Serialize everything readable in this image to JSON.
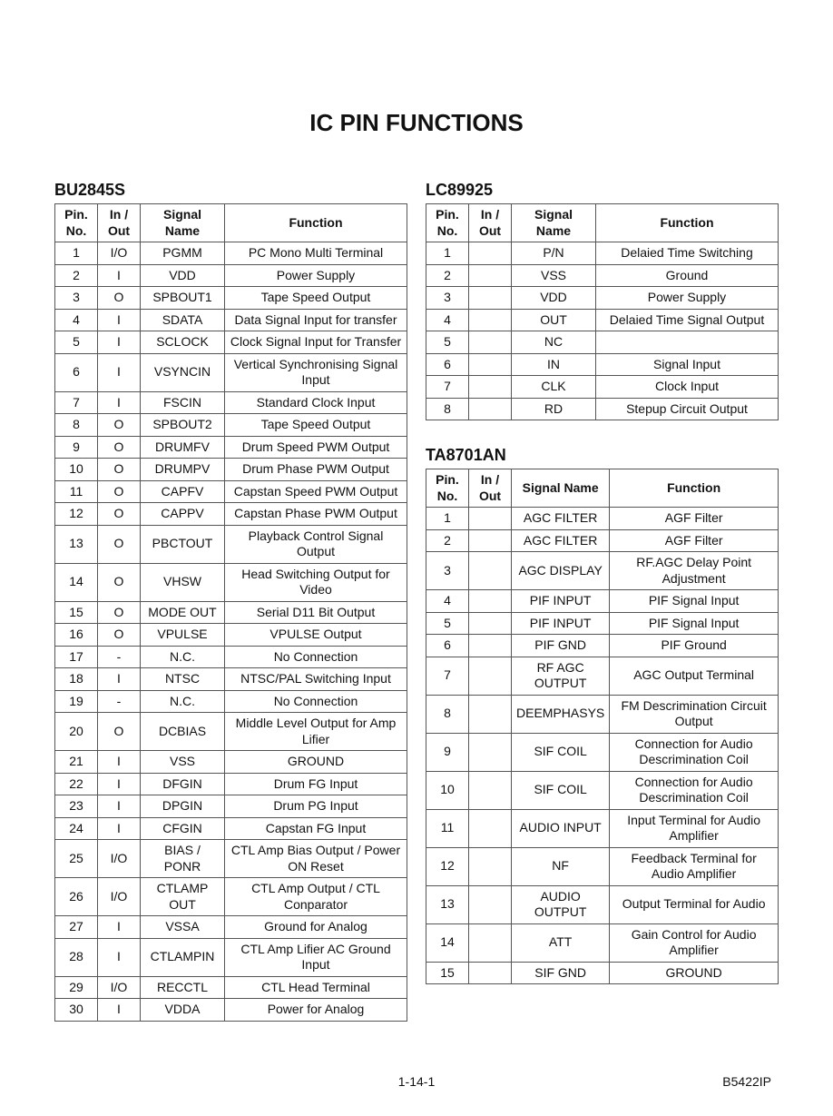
{
  "page_title": "IC PIN FUNCTIONS",
  "footer_center": "1-14-1",
  "footer_right": "B5422IP",
  "headers": {
    "pin": "Pin.\nNo.",
    "io": "In /\nOut",
    "signal": "Signal\nName",
    "func": "Function"
  },
  "tables": [
    {
      "title": "BU2845S",
      "rows": [
        {
          "pin": "1",
          "io": "I/O",
          "signal": "PGMM",
          "func": "PC Mono Multi Terminal"
        },
        {
          "pin": "2",
          "io": "I",
          "signal": "VDD",
          "func": "Power Supply"
        },
        {
          "pin": "3",
          "io": "O",
          "signal": "SPBOUT1",
          "func": "Tape Speed Output"
        },
        {
          "pin": "4",
          "io": "I",
          "signal": "SDATA",
          "func": "Data Signal Input for transfer"
        },
        {
          "pin": "5",
          "io": "I",
          "signal": "SCLOCK",
          "func": "Clock Signal Input for Transfer"
        },
        {
          "pin": "6",
          "io": "I",
          "signal": "VSYNCIN",
          "func": "Vertical Synchronising Signal Input"
        },
        {
          "pin": "7",
          "io": "I",
          "signal": "FSCIN",
          "func": "Standard Clock Input"
        },
        {
          "pin": "8",
          "io": "O",
          "signal": "SPBOUT2",
          "func": "Tape Speed Output"
        },
        {
          "pin": "9",
          "io": "O",
          "signal": "DRUMFV",
          "func": "Drum Speed PWM Output"
        },
        {
          "pin": "10",
          "io": "O",
          "signal": "DRUMPV",
          "func": "Drum Phase PWM Output"
        },
        {
          "pin": "11",
          "io": "O",
          "signal": "CAPFV",
          "func": "Capstan Speed PWM Output"
        },
        {
          "pin": "12",
          "io": "O",
          "signal": "CAPPV",
          "func": "Capstan Phase PWM Output"
        },
        {
          "pin": "13",
          "io": "O",
          "signal": "PBCTOUT",
          "func": "Playback Control Signal Output"
        },
        {
          "pin": "14",
          "io": "O",
          "signal": "VHSW",
          "func": "Head Switching Output for Video"
        },
        {
          "pin": "15",
          "io": "O",
          "signal": "MODE OUT",
          "func": "Serial D11 Bit Output"
        },
        {
          "pin": "16",
          "io": "O",
          "signal": "VPULSE",
          "func": "VPULSE Output"
        },
        {
          "pin": "17",
          "io": "-",
          "signal": "N.C.",
          "func": "No Connection"
        },
        {
          "pin": "18",
          "io": "I",
          "signal": "NTSC",
          "func": "NTSC/PAL Switching Input"
        },
        {
          "pin": "19",
          "io": "-",
          "signal": "N.C.",
          "func": "No Connection"
        },
        {
          "pin": "20",
          "io": "O",
          "signal": "DCBIAS",
          "func": "Middle Level Output for Amp Lifier"
        },
        {
          "pin": "21",
          "io": "I",
          "signal": "VSS",
          "func": "GROUND"
        },
        {
          "pin": "22",
          "io": "I",
          "signal": "DFGIN",
          "func": "Drum FG Input"
        },
        {
          "pin": "23",
          "io": "I",
          "signal": "DPGIN",
          "func": "Drum PG Input"
        },
        {
          "pin": "24",
          "io": "I",
          "signal": "CFGIN",
          "func": "Capstan FG Input"
        },
        {
          "pin": "25",
          "io": "I/O",
          "signal": "BIAS / PONR",
          "func": "CTL Amp Bias Output / Power ON Reset"
        },
        {
          "pin": "26",
          "io": "I/O",
          "signal": "CTLAMP OUT",
          "func": "CTL Amp Output / CTL Conparator"
        },
        {
          "pin": "27",
          "io": "I",
          "signal": "VSSA",
          "func": "Ground for Analog"
        },
        {
          "pin": "28",
          "io": "I",
          "signal": "CTLAMPIN",
          "func": "CTL Amp Lifier AC Ground Input"
        },
        {
          "pin": "29",
          "io": "I/O",
          "signal": "RECCTL",
          "func": "CTL Head Terminal"
        },
        {
          "pin": "30",
          "io": "I",
          "signal": "VDDA",
          "func": "Power for Analog"
        }
      ]
    },
    {
      "title": "LC89925",
      "rows": [
        {
          "pin": "1",
          "io": "",
          "signal": "P/N",
          "func": "Delaied Time Switching"
        },
        {
          "pin": "2",
          "io": "",
          "signal": "VSS",
          "func": "Ground"
        },
        {
          "pin": "3",
          "io": "",
          "signal": "VDD",
          "func": "Power Supply"
        },
        {
          "pin": "4",
          "io": "",
          "signal": "OUT",
          "func": "Delaied Time Signal Output"
        },
        {
          "pin": "5",
          "io": "",
          "signal": "NC",
          "func": ""
        },
        {
          "pin": "6",
          "io": "",
          "signal": "IN",
          "func": "Signal Input"
        },
        {
          "pin": "7",
          "io": "",
          "signal": "CLK",
          "func": "Clock Input"
        },
        {
          "pin": "8",
          "io": "",
          "signal": "RD",
          "func": "Stepup Circuit Output"
        }
      ]
    },
    {
      "title": "TA8701AN",
      "rows": [
        {
          "pin": "1",
          "io": "",
          "signal": "AGC FILTER",
          "func": "AGF Filter"
        },
        {
          "pin": "2",
          "io": "",
          "signal": "AGC FILTER",
          "func": "AGF Filter"
        },
        {
          "pin": "3",
          "io": "",
          "signal": "AGC DISPLAY",
          "func": "RF.AGC Delay Point Adjustment"
        },
        {
          "pin": "4",
          "io": "",
          "signal": "PIF INPUT",
          "func": "PIF Signal Input"
        },
        {
          "pin": "5",
          "io": "",
          "signal": "PIF INPUT",
          "func": "PIF Signal Input"
        },
        {
          "pin": "6",
          "io": "",
          "signal": "PIF GND",
          "func": "PIF Ground"
        },
        {
          "pin": "7",
          "io": "",
          "signal": "RF AGC OUTPUT",
          "func": "AGC Output Terminal"
        },
        {
          "pin": "8",
          "io": "",
          "signal": "DEEMPHASYS",
          "func": "FM Descrimination Circuit Output"
        },
        {
          "pin": "9",
          "io": "",
          "signal": "SIF COIL",
          "func": "Connection for Audio Descrimination Coil"
        },
        {
          "pin": "10",
          "io": "",
          "signal": "SIF COIL",
          "func": "Connection for Audio Descrimination Coil"
        },
        {
          "pin": "11",
          "io": "",
          "signal": "AUDIO INPUT",
          "func": "Input Terminal for Audio Amplifier"
        },
        {
          "pin": "12",
          "io": "",
          "signal": "NF",
          "func": "Feedback Terminal for Audio Amplifier"
        },
        {
          "pin": "13",
          "io": "",
          "signal": "AUDIO OUTPUT",
          "func": "Output Terminal for Audio"
        },
        {
          "pin": "14",
          "io": "",
          "signal": "ATT",
          "func": "Gain Control for Audio Amplifier"
        },
        {
          "pin": "15",
          "io": "",
          "signal": "SIF GND",
          "func": "GROUND"
        }
      ]
    }
  ]
}
